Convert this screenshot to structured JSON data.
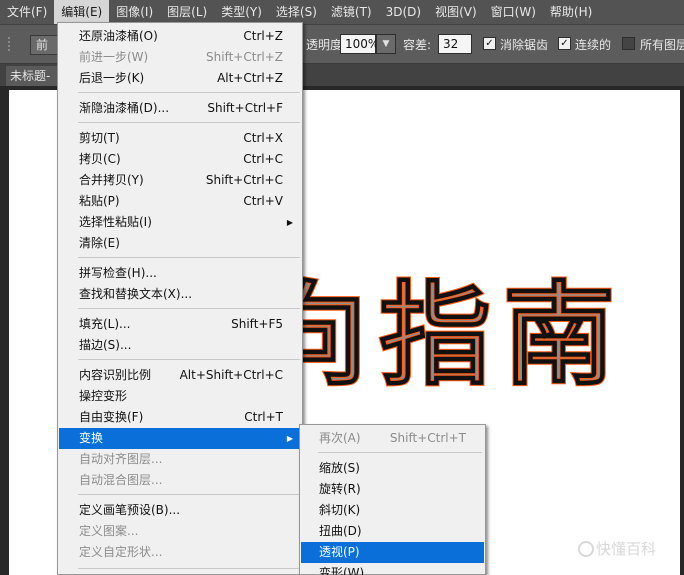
{
  "menubar": {
    "items": [
      "文件(F)",
      "编辑(E)",
      "图像(I)",
      "图层(L)",
      "类型(Y)",
      "选择(S)",
      "滤镜(T)",
      "3D(D)",
      "视图(V)",
      "窗口(W)",
      "帮助(H)"
    ],
    "active_index": 1
  },
  "options_bar": {
    "fill_source": "前景",
    "opacity_label": "透明度:",
    "opacity_value": "100%",
    "tolerance_label": "容差:",
    "tolerance_value": "32",
    "antialias_label": "消除锯齿",
    "antialias_checked": true,
    "contiguous_label": "连续的",
    "contiguous_checked": true,
    "all_layers_label": "所有图层",
    "all_layers_checked": false
  },
  "document_tab": {
    "title": "未标题-"
  },
  "canvas": {
    "text": "向指南",
    "watermark": "快懂百科"
  },
  "edit_menu": {
    "items": [
      {
        "label": "还原油漆桶(O)",
        "shortcut": "Ctrl+Z",
        "enabled": true
      },
      {
        "label": "前进一步(W)",
        "shortcut": "Shift+Ctrl+Z",
        "enabled": false
      },
      {
        "label": "后退一步(K)",
        "shortcut": "Alt+Ctrl+Z",
        "enabled": true
      },
      {
        "label": "渐隐油漆桶(D)...",
        "shortcut": "Shift+Ctrl+F",
        "enabled": true
      },
      {
        "label": "剪切(T)",
        "shortcut": "Ctrl+X",
        "enabled": true
      },
      {
        "label": "拷贝(C)",
        "shortcut": "Ctrl+C",
        "enabled": true
      },
      {
        "label": "合并拷贝(Y)",
        "shortcut": "Shift+Ctrl+C",
        "enabled": true
      },
      {
        "label": "粘贴(P)",
        "shortcut": "Ctrl+V",
        "enabled": true
      },
      {
        "label": "选择性粘贴(I)",
        "shortcut": "",
        "enabled": true,
        "submenu": true
      },
      {
        "label": "清除(E)",
        "shortcut": "",
        "enabled": true
      },
      {
        "label": "拼写检查(H)...",
        "shortcut": "",
        "enabled": true
      },
      {
        "label": "查找和替换文本(X)...",
        "shortcut": "",
        "enabled": true
      },
      {
        "label": "填充(L)...",
        "shortcut": "Shift+F5",
        "enabled": true
      },
      {
        "label": "描边(S)...",
        "shortcut": "",
        "enabled": true
      },
      {
        "label": "内容识别比例",
        "shortcut": "Alt+Shift+Ctrl+C",
        "enabled": true
      },
      {
        "label": "操控变形",
        "shortcut": "",
        "enabled": true
      },
      {
        "label": "自由变换(F)",
        "shortcut": "Ctrl+T",
        "enabled": true
      },
      {
        "label": "变换",
        "shortcut": "",
        "enabled": true,
        "submenu": true,
        "highlighted": true
      },
      {
        "label": "自动对齐图层...",
        "shortcut": "",
        "enabled": false
      },
      {
        "label": "自动混合图层...",
        "shortcut": "",
        "enabled": false
      },
      {
        "label": "定义画笔预设(B)...",
        "shortcut": "",
        "enabled": true
      },
      {
        "label": "定义图案...",
        "shortcut": "",
        "enabled": false
      },
      {
        "label": "定义自定形状...",
        "shortcut": "",
        "enabled": false
      }
    ]
  },
  "transform_submenu": {
    "items": [
      {
        "label": "再次(A)",
        "shortcut": "Shift+Ctrl+T",
        "enabled": false
      },
      {
        "label": "缩放(S)",
        "shortcut": "",
        "enabled": true
      },
      {
        "label": "旋转(R)",
        "shortcut": "",
        "enabled": true
      },
      {
        "label": "斜切(K)",
        "shortcut": "",
        "enabled": true
      },
      {
        "label": "扭曲(D)",
        "shortcut": "",
        "enabled": true
      },
      {
        "label": "透视(P)",
        "shortcut": "",
        "enabled": true,
        "highlighted": true
      },
      {
        "label": "变形(W)",
        "shortcut": "",
        "enabled": true
      }
    ]
  },
  "colors": {
    "highlight": "#0a6fd8",
    "selection_glow": "#ff5a14",
    "text_fill": "#8e8e8e"
  }
}
